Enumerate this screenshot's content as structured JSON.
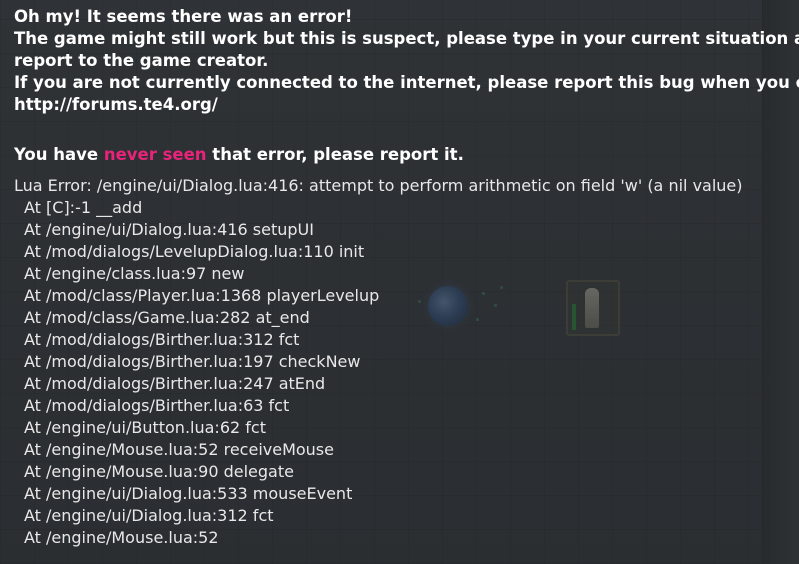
{
  "error": {
    "title": "Oh my! It seems there was an error!",
    "instructions_line1": "The game might still work but this is suspect, please type in your current situation a",
    "instructions_line2": "report to the game creator.",
    "offline_line": "If you are not currently connected to the internet, please report this bug when you c",
    "forum_url": "http://forums.te4.org/",
    "seen_prefix": "You have ",
    "seen_highlight": "never seen",
    "seen_suffix": " that error, please report it.",
    "lua_error": "Lua Error: /engine/ui/Dialog.lua:416: attempt to perform arithmetic on field 'w' (a nil value)",
    "traceback": [
      "At [C]:-1 __add",
      "At /engine/ui/Dialog.lua:416 setupUI",
      "At /mod/dialogs/LevelupDialog.lua:110 init",
      "At /engine/class.lua:97 new",
      "At /mod/class/Player.lua:1368 playerLevelup",
      "At /mod/class/Game.lua:282 at_end",
      "At /mod/dialogs/Birther.lua:312 fct",
      "At /mod/dialogs/Birther.lua:197 checkNew",
      "At /mod/dialogs/Birther.lua:247 atEnd",
      "At /mod/dialogs/Birther.lua:63 fct",
      "At /engine/ui/Button.lua:62 fct",
      "At /engine/Mouse.lua:52 receiveMouse",
      "At /engine/Mouse.lua:90 delegate",
      "At /engine/ui/Dialog.lua:533 mouseEvent",
      "At /engine/ui/Dialog.lua:312 fct",
      "At /engine/Mouse.lua:52"
    ]
  },
  "colors": {
    "highlight": "#e8237a",
    "text": "#ffffff",
    "overlay": "#232629"
  }
}
